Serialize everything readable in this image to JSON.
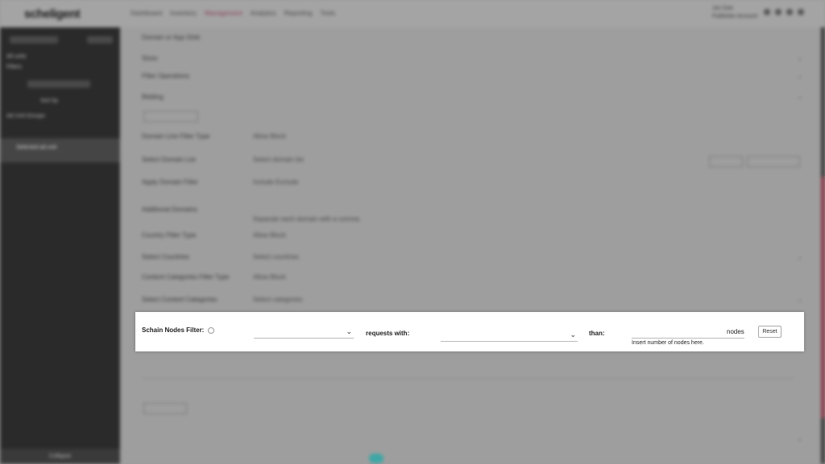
{
  "app": {
    "logo": "scheligent",
    "nav": [
      "Dashboard",
      "Inventory",
      "Management",
      "Analytics",
      "Reporting",
      "Tools"
    ],
    "user": {
      "name": "Jon Doe",
      "org": "Publisher Account"
    }
  },
  "sidebar": {
    "items": [
      {
        "label": "All units"
      },
      {
        "label": "Filters"
      },
      {
        "label": "Sort by"
      },
      {
        "label": "Ad Unit Groups"
      },
      {
        "label": "Selected ad unit"
      }
    ],
    "bottom_label": "Collapse"
  },
  "form_rows": [
    {
      "label": "Domain or App Glob",
      "value": ""
    },
    {
      "label": "Sizes",
      "value": ""
    },
    {
      "label": "Filter Operations",
      "value": ""
    },
    {
      "label": "Bidding",
      "value": ""
    },
    {
      "label": "Domain Line Filter Type",
      "value": "Allow  Block"
    },
    {
      "label": "Select Domain List",
      "value": "Select domain list"
    },
    {
      "label": "Apply Domain Filter",
      "value": "Include  Exclude"
    },
    {
      "label": "Additional Domains",
      "value": "Separate each domain with a comma"
    },
    {
      "label": "Country Filter Type",
      "value": "Allow  Block"
    },
    {
      "label": "Select Countries",
      "value": "Select countries"
    },
    {
      "label": "Content Categories Filter Type",
      "value": "Allow  Block"
    },
    {
      "label": "Select Content Categories",
      "value": "Select categories"
    }
  ],
  "filter_panel": {
    "label": "Schain Nodes Filter:",
    "select_1": {
      "value": ""
    },
    "middle_text": "requests with:",
    "select_2": {
      "value": ""
    },
    "than_text": "than:",
    "input": {
      "value": "",
      "placeholder": ""
    },
    "unit": "nodes",
    "hint": "Insert number of nodes here.",
    "reset_label": "Reset"
  },
  "colors": {
    "accent": "#8a3e56",
    "sidebar_bg": "#2a2a2a",
    "panel_bg": "#ffffff",
    "fab": "#3fa6a6"
  }
}
